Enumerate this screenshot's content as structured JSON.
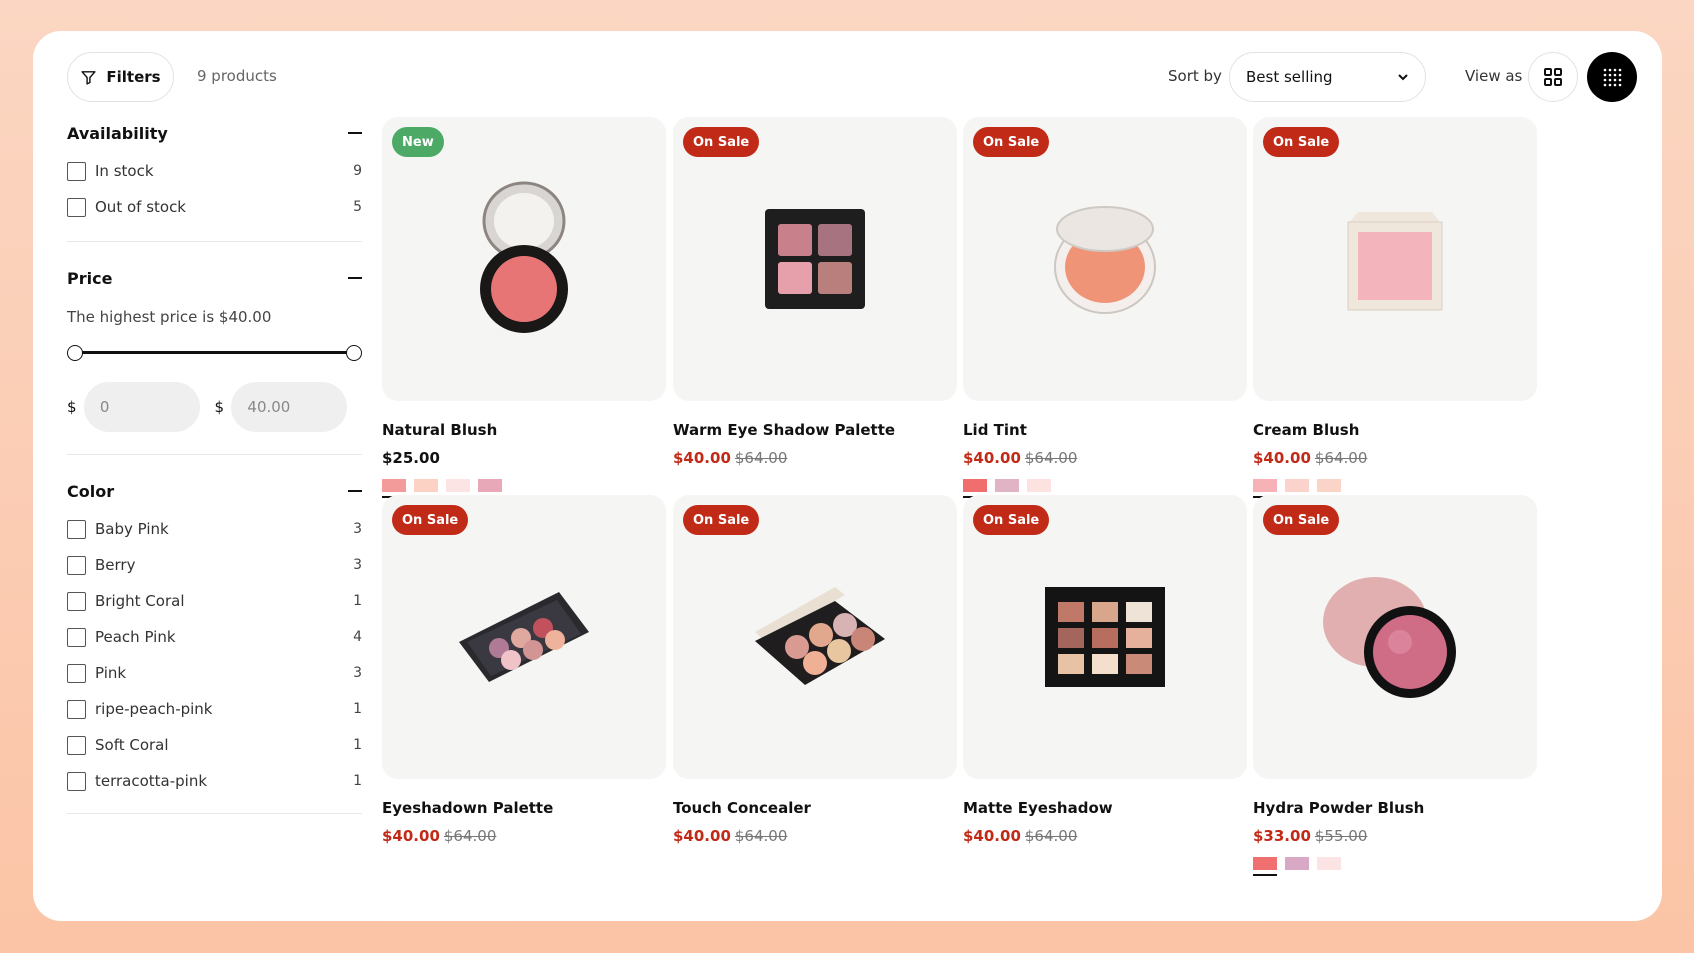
{
  "toolbar": {
    "filters_label": "Filters",
    "product_count": "9 products",
    "sort_label": "Sort by",
    "sort_value": "Best selling",
    "view_label": "View as"
  },
  "sidebar": {
    "availability": {
      "title": "Availability",
      "options": [
        {
          "label": "In stock",
          "count": "9"
        },
        {
          "label": "Out of stock",
          "count": "5"
        }
      ]
    },
    "price": {
      "title": "Price",
      "note": "The highest price is $40.00",
      "currency": "$",
      "min_value": "0",
      "max_value": "40.00",
      "range_fraction": [
        0,
        1
      ]
    },
    "color": {
      "title": "Color",
      "options": [
        {
          "label": "Baby Pink",
          "count": "3"
        },
        {
          "label": "Berry",
          "count": "3"
        },
        {
          "label": "Bright Coral",
          "count": "1"
        },
        {
          "label": "Peach Pink",
          "count": "4"
        },
        {
          "label": "Pink",
          "count": "3"
        },
        {
          "label": "ripe-peach-pink",
          "count": "1"
        },
        {
          "label": "Soft Coral",
          "count": "1"
        },
        {
          "label": "terracotta-pink",
          "count": "1"
        }
      ]
    }
  },
  "products": [
    {
      "name": "Natural Blush",
      "badge": "New",
      "price": "$25.00",
      "was": "",
      "swatches": [
        "#f39a9a",
        "#fcd2c4",
        "#fde4e4",
        "#e8a8b8"
      ]
    },
    {
      "name": "Warm Eye Shadow Palette",
      "badge": "On Sale",
      "price": "$40.00",
      "was": "$64.00",
      "swatches": []
    },
    {
      "name": "Lid Tint",
      "badge": "On Sale",
      "price": "$40.00",
      "was": "$64.00",
      "swatches": [
        "#f06e6e",
        "#e0b4c4",
        "#fde2e2"
      ]
    },
    {
      "name": "Cream Blush",
      "badge": "On Sale",
      "price": "$40.00",
      "was": "$64.00",
      "swatches": [
        "#f6b2b6",
        "#fcd2cc",
        "#fbd4c8"
      ]
    },
    {
      "name": "Eyeshadown Palette",
      "badge": "On Sale",
      "price": "$40.00",
      "was": "$64.00",
      "swatches": []
    },
    {
      "name": "Touch Concealer",
      "badge": "On Sale",
      "price": "$40.00",
      "was": "$64.00",
      "swatches": []
    },
    {
      "name": "Matte Eyeshadow",
      "badge": "On Sale",
      "price": "$40.00",
      "was": "$64.00",
      "swatches": []
    },
    {
      "name": "Hydra Powder Blush",
      "badge": "On Sale",
      "price": "$33.00",
      "was": "$55.00",
      "swatches": [
        "#f07070",
        "#d8a8c4",
        "#fde4e4"
      ]
    }
  ],
  "colors": {
    "sale_badge": "#c22a18",
    "new_badge": "#4caa66",
    "sale_price": "#c22a18"
  }
}
